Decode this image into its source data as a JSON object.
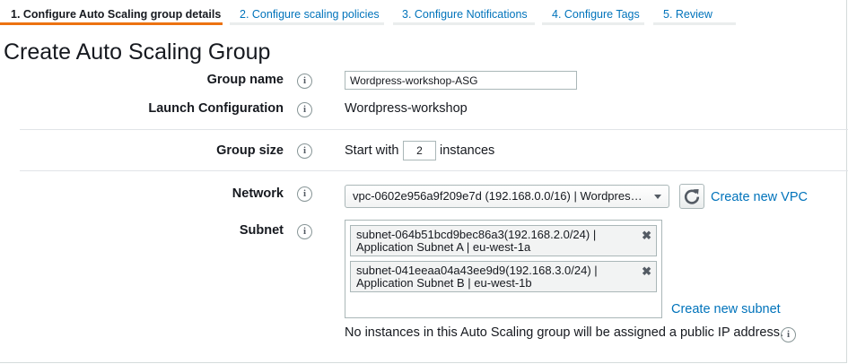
{
  "tabs": [
    {
      "label": "1. Configure Auto Scaling group details",
      "active": true
    },
    {
      "label": "2. Configure scaling policies",
      "active": false
    },
    {
      "label": "3. Configure Notifications",
      "active": false
    },
    {
      "label": "4. Configure Tags",
      "active": false
    },
    {
      "label": "5. Review",
      "active": false
    }
  ],
  "page_title": "Create Auto Scaling Group",
  "info_glyph": "i",
  "fields": {
    "group_name": {
      "label": "Group name",
      "value": "Wordpress-workshop-ASG"
    },
    "launch_configuration": {
      "label": "Launch Configuration",
      "value": "Wordpress-workshop"
    },
    "group_size": {
      "label": "Group size",
      "prefix": "Start with",
      "value": "2",
      "suffix": "instances"
    },
    "network": {
      "label": "Network",
      "value": "vpc-0602e956a9f209e7d (192.168.0.0/16) | Wordpres…",
      "create_link": "Create new VPC"
    },
    "subnet": {
      "label": "Subnet",
      "items": [
        {
          "line1": "subnet-064b51bcd9bec86a3(192.168.2.0/24) |",
          "line2": "Application Subnet A | eu-west-1a"
        },
        {
          "line1": "subnet-041eeaa04a43ee9d9(192.168.3.0/24) |",
          "line2": "Application Subnet B | eu-west-1b"
        }
      ],
      "remove_glyph": "✖",
      "create_link": "Create new subnet",
      "note": "No instances in this Auto Scaling group will be assigned a public IP address."
    }
  },
  "colors": {
    "accent": "#ec7211",
    "link": "#0073bb",
    "text": "#16191f"
  }
}
